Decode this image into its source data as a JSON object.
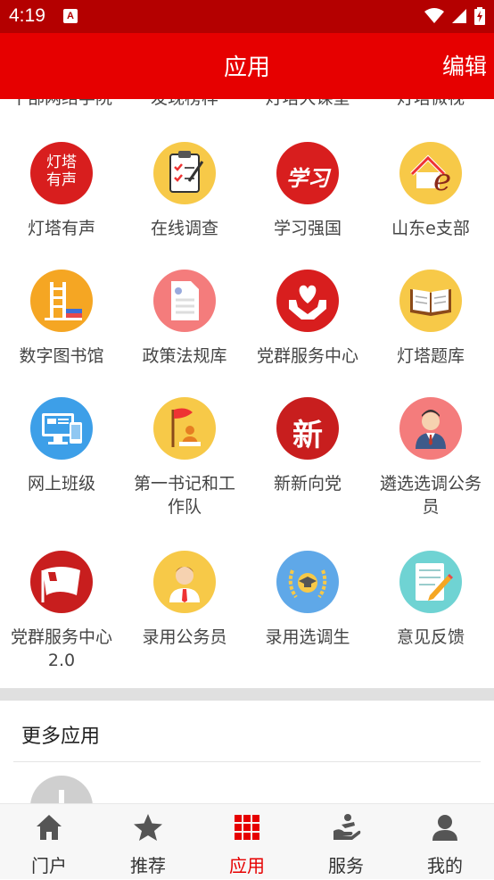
{
  "status": {
    "time": "4:19",
    "notif": "A"
  },
  "header": {
    "title": "应用",
    "edit": "编辑"
  },
  "cut_row": [
    "干部网络学院",
    "发现榜样",
    "灯塔大课堂",
    "灯塔微视"
  ],
  "apps": [
    {
      "label": "灯塔有声",
      "icon": "dengta-youxing-icon",
      "color": "#d81e1e",
      "badge_text": "灯塔有声"
    },
    {
      "label": "在线调查",
      "icon": "clipboard-survey-icon",
      "color": "#f7c948"
    },
    {
      "label": "学习强国",
      "icon": "xuexi-qiangguo-icon",
      "color": "#d81e1e",
      "badge_text": "学习"
    },
    {
      "label": "山东e支部",
      "icon": "house-e-icon",
      "color": "#f7c948"
    },
    {
      "label": "数字图书馆",
      "icon": "library-icon",
      "color": "#f5a623"
    },
    {
      "label": "政策法规库",
      "icon": "document-icon",
      "color": "#f47c7c"
    },
    {
      "label": "党群服务中心",
      "icon": "hands-heart-icon",
      "color": "#d81e1e"
    },
    {
      "label": "灯塔题库",
      "icon": "open-book-icon",
      "color": "#f7c948"
    },
    {
      "label": "网上班级",
      "icon": "computer-icon",
      "color": "#3d9fe8"
    },
    {
      "label": "第一书记和工作队",
      "icon": "flag-person-icon",
      "color": "#f7c948"
    },
    {
      "label": "新新向党",
      "icon": "xinxin-party-icon",
      "color": "#d81e1e",
      "badge_text": "新"
    },
    {
      "label": "遴选选调公务员",
      "icon": "officer-icon",
      "color": "#f47c7c"
    },
    {
      "label": "党群服务中心2.0",
      "icon": "party-flag-icon",
      "color": "#c81e1e"
    },
    {
      "label": "录用公务员",
      "icon": "civil-servant-icon",
      "color": "#f7c948"
    },
    {
      "label": "录用选调生",
      "icon": "graduate-laurel-icon",
      "color": "#5fa8e8"
    },
    {
      "label": "意见反馈",
      "icon": "notepad-pencil-icon",
      "color": "#6fd3d3"
    }
  ],
  "more": {
    "title": "更多应用",
    "add_icon": "plus-icon"
  },
  "tabs": [
    {
      "label": "门户",
      "icon": "home-icon"
    },
    {
      "label": "推荐",
      "icon": "star-icon"
    },
    {
      "label": "应用",
      "icon": "grid-icon",
      "active": true
    },
    {
      "label": "服务",
      "icon": "service-icon"
    },
    {
      "label": "我的",
      "icon": "person-icon"
    }
  ]
}
